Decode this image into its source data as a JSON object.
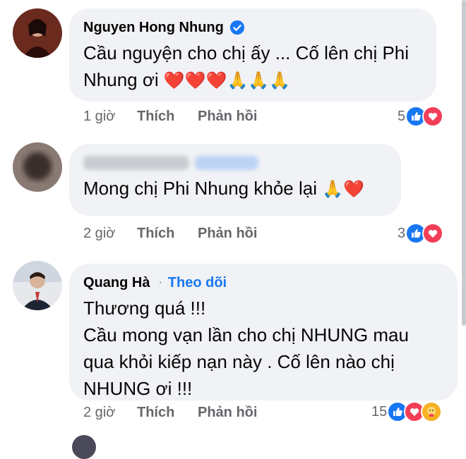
{
  "comments": [
    {
      "author": "Nguyen Hong Nhung",
      "verified": true,
      "lines": [
        "Cầu nguyện cho chị ấy ... Cố lên chị Phi",
        "Nhung ơi "
      ],
      "emoji_tail": "❤️❤️❤️🙏🙏🙏",
      "time": "1 giờ",
      "like_label": "Thích",
      "reply_label": "Phản hồi",
      "reaction_count": "5",
      "reactions": [
        "like-icon",
        "love-icon"
      ]
    },
    {
      "author_hidden": true,
      "lines": [
        "Mong chị Phi Nhung khỏe lại "
      ],
      "emoji_tail": "🙏❤️",
      "time": "2 giờ",
      "like_label": "Thích",
      "reply_label": "Phản hồi",
      "reaction_count": "3",
      "reactions": [
        "like-icon",
        "love-icon"
      ]
    },
    {
      "author": "Quang Hà",
      "separator": "·",
      "follow_label": "Theo dõi",
      "lines": [
        "Thương quá !!!",
        "Cầu mong vạn lần cho chị NHUNG mau",
        "qua khỏi kiếp nạn này . Cố lên nào chị",
        "NHUNG ơi !!!"
      ],
      "time": "2 giờ",
      "like_label": "Thích",
      "reply_label": "Phản hồi",
      "reaction_count": "15",
      "reactions": [
        "like-icon",
        "love-icon",
        "care-icon"
      ]
    }
  ],
  "colors": {
    "bubble": "#f0f2f5",
    "link": "#1877f2",
    "meta": "#65676b",
    "like_blue": "#1877f2",
    "love_red": "#f33e58"
  }
}
